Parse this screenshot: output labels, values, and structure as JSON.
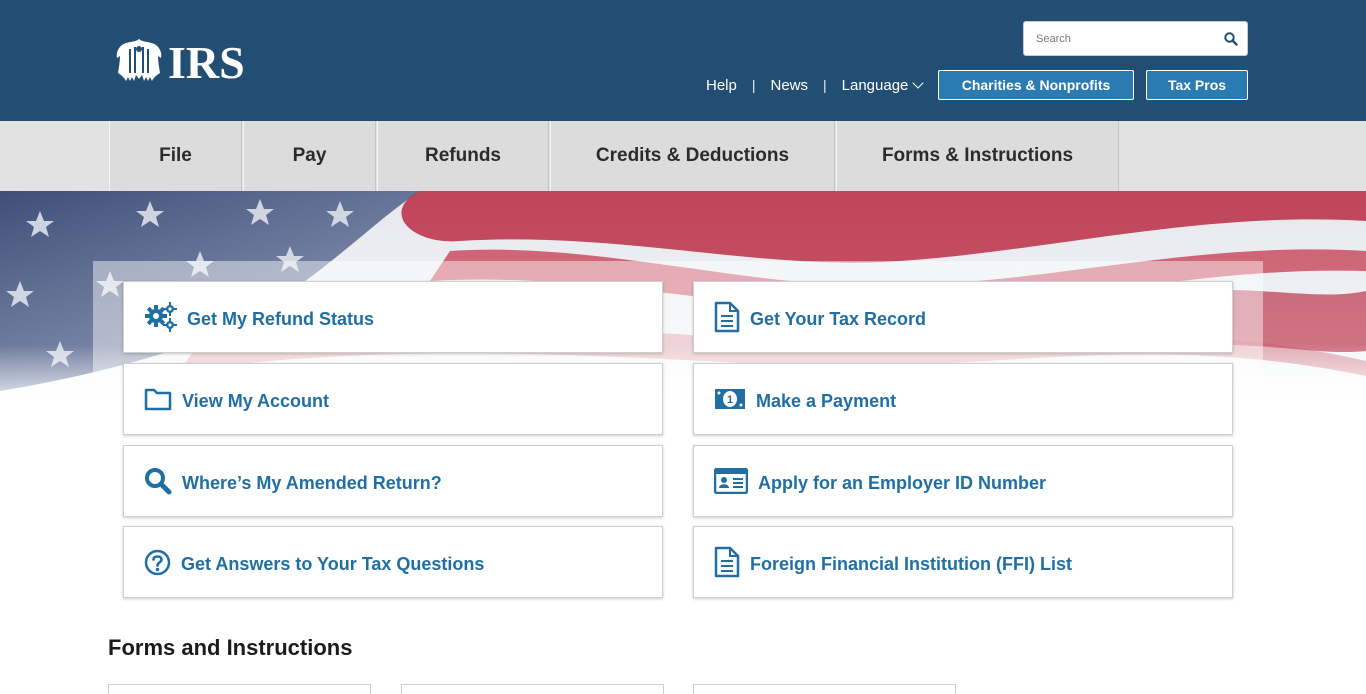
{
  "header": {
    "logo_text": "IRS",
    "search": {
      "placeholder": "Search"
    },
    "utility_links": [
      "Help",
      "News",
      "Language"
    ],
    "buttons": {
      "charities": "Charities & Nonprofits",
      "tax_pros": "Tax Pros"
    }
  },
  "main_nav": [
    "File",
    "Pay",
    "Refunds",
    "Credits & Deductions",
    "Forms & Instructions"
  ],
  "cards": {
    "refund_status": "Get My Refund Status",
    "tax_record": "Get Your Tax Record",
    "view_account": "View My Account",
    "make_payment": "Make a Payment",
    "amended_return": "Where’s My Amended Return?",
    "employer_id": "Apply for an Employer ID Number",
    "tax_questions": "Get Answers to Your Tax Questions",
    "ffi_list": "Foreign Financial Institution (FFI) List"
  },
  "forms_section": {
    "title": "Forms and Instructions"
  },
  "colors": {
    "header_bg": "#234e74",
    "link_blue": "#1f6fa5",
    "pill_blue": "#2a7bb2",
    "nav_bg": "#dcdcdc"
  },
  "icons": [
    "eagle-logo-icon",
    "search-icon",
    "chevron-down-icon",
    "gears-icon",
    "document-icon",
    "folder-icon",
    "magnifier-icon",
    "money-bill-icon",
    "id-card-icon",
    "question-circle-icon"
  ]
}
